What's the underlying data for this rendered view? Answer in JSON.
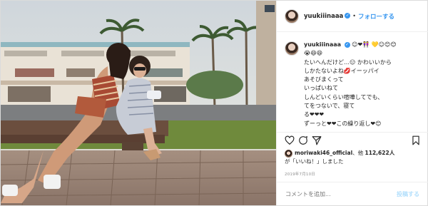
{
  "header": {
    "username": "yuukiiinaaa",
    "verified_mark": "✓",
    "separator": "•",
    "follow_label": "フォローする"
  },
  "caption": {
    "username": "yuukiiinaaa",
    "lines": [
      "☺❤👭 💛☺😊😊",
      "😭😆😆",
      "たいへんだけど…😑 かわいいから",
      "しかたないよね💋イーッパイ",
      "あそびまくって",
      "いっぱいねて",
      "しんどいくらい喧嘩してでも、",
      "てをつないで、寝て",
      "る❤❤❤",
      "ずーっと❤❤この繰り返し❤😊"
    ]
  },
  "icons": {
    "heart": "heart-icon",
    "comment": "comment-icon",
    "share": "share-icon",
    "bookmark": "bookmark-icon"
  },
  "likes": {
    "liker": "moriwaki46_official",
    "text1": "、他",
    "count": "112,622人",
    "text2": "が「いいね！」しました"
  },
  "date": "2019年7月10日",
  "comment_box": {
    "placeholder": "コメントを追加...",
    "post_label": "投稿する"
  },
  "colors": {
    "accent": "#3897f0",
    "post_disabled": "#b2dffc",
    "border": "#dbdbdb"
  }
}
